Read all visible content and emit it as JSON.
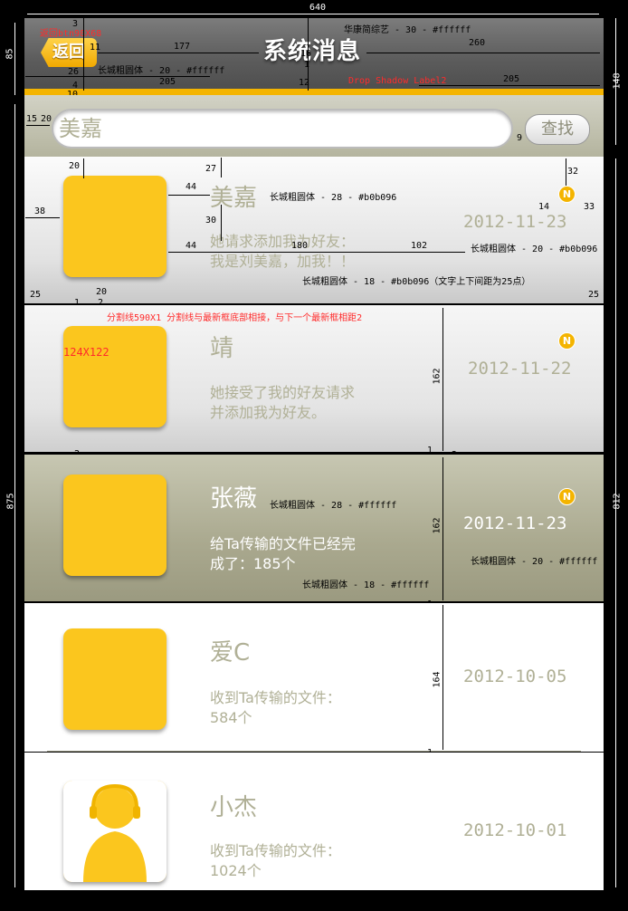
{
  "canvas": {
    "width_label": "640",
    "height_header_label": "85",
    "height_total_label": "875",
    "right_header_label": "148",
    "right_total_label": "812"
  },
  "header": {
    "back_label": "返回",
    "title": "系统消息",
    "back_asset": "返回btn98X68",
    "font_note": "华康简综艺 - 30 - #ffffff",
    "back_font_note": "长城粗圆体 - 20 - #ffffff",
    "shadow_note": "Drop Shadow Label2",
    "dims": {
      "d3": "3",
      "d11": "11",
      "d177": "177",
      "d26": "26",
      "d4": "4",
      "d205a": "205",
      "d10": "10",
      "d8": "8",
      "d12": "12",
      "d16": "16",
      "d1": "1",
      "d260": "260",
      "d205b": "205"
    }
  },
  "search": {
    "value": "美嘉",
    "button": "查找",
    "dims": {
      "d15": "15",
      "d20": "20",
      "d9": "9",
      "d4": "4",
      "d2": "2",
      "d20b": "20"
    }
  },
  "messages": [
    {
      "name": "美嘉",
      "text_line1": "她请求添加我为好友：",
      "text_line2": "我是刘美嘉，加我！！",
      "date": "2012-11-23",
      "badge": "N",
      "name_color": "#b0b096",
      "text_color": "#b0b096",
      "date_color": "#b0b096"
    },
    {
      "name": "靖",
      "text_line1": "她接受了我的好友请求",
      "text_line2": "并添加我为好友。",
      "date": "2012-11-22",
      "badge": "N",
      "name_color": "#b0b096",
      "text_color": "#b0b096",
      "date_color": "#b0b096"
    },
    {
      "name": "张薇",
      "text_line1": "给Ta传输的文件已经完",
      "text_line2": "成了：185个",
      "date": "2012-11-23",
      "badge": "N",
      "name_color": "#ffffff",
      "text_color": "#ffffff",
      "date_color": "#ffffff"
    },
    {
      "name": "爱C",
      "text_line1": "收到Ta传输的文件：",
      "text_line2": "584个",
      "date": "2012-10-05",
      "badge": "",
      "name_color": "#b0b096",
      "text_color": "#b0b096",
      "date_color": "#b0b096"
    },
    {
      "name": "小杰",
      "text_line1": "收到Ta传输的文件：",
      "text_line2": "1024个",
      "date": "2012-10-01",
      "badge": "",
      "name_color": "#b0b096",
      "text_color": "#b0b096",
      "date_color": "#b0b096"
    }
  ],
  "annotations": {
    "name_font": "长城粗圆体 - 28 - #b0b096",
    "date_font": "长城粗圆体 - 20 - #b0b096",
    "text_font": "长城粗圆体 - 18 - #b0b096（文字上下间距为25点）",
    "name_font_white": "长城粗圆体 - 28 - #ffffff",
    "date_font_white": "长城粗圆体 - 20 - #ffffff",
    "text_font_white": "长城粗圆体 - 18 - #ffffff",
    "divider_note": "分割线590X1    分割线与最新框底部相接，与下一个最新框相距2",
    "avatar_size": "124X122",
    "d27": "27",
    "d44a": "44",
    "d30": "30",
    "d44b": "44",
    "d180": "180",
    "d102": "102",
    "d38": "38",
    "d32": "32",
    "d14": "14",
    "d33": "33",
    "d25a": "25",
    "d25b": "25",
    "d20": "20",
    "d1a": "1",
    "d2a": "2",
    "d162a": "162",
    "d1b": "1",
    "d2b": "2",
    "d2c": "2",
    "d162b": "162",
    "d1c": "1",
    "d164": "164",
    "d1d": "1"
  },
  "colors": {
    "accent": "#f4b400",
    "avatar": "#fbc61e",
    "muted": "#b0b096"
  }
}
